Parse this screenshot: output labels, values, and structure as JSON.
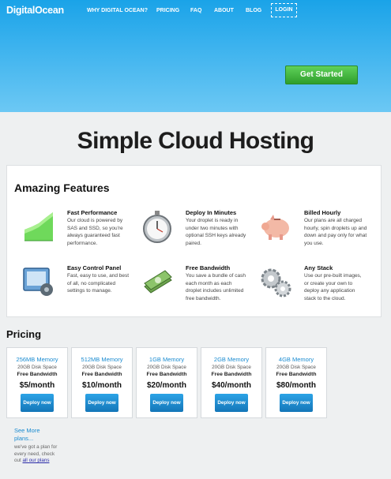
{
  "header": {
    "logo": "DigitalOcean",
    "nav": [
      "WHY DIGITAL OCEAN?",
      "PRICING",
      "FAQ",
      "ABOUT",
      "BLOG"
    ],
    "login": "LOGIN"
  },
  "hero": {
    "cta": "Get Started"
  },
  "headline": "Simple Cloud Hosting",
  "features": {
    "title": "Amazing Features",
    "items": [
      {
        "title": "Fast Performance",
        "desc": "Our cloud is powered by SAS and SSD, so you're always guaranteed fast performance.",
        "icon": "chart-icon"
      },
      {
        "title": "Deploy In Minutes",
        "desc": "Your droplet is ready in under two minutes with optional SSH keys already paired.",
        "icon": "stopwatch-icon"
      },
      {
        "title": "Billed Hourly",
        "desc": "Our plans are all charged hourly, spin droplets up and down and pay only for what you use.",
        "icon": "piggy-bank-icon"
      },
      {
        "title": "Easy Control Panel",
        "desc": "Fast, easy to use, and best of all, no complicated settings to manage.",
        "icon": "control-panel-icon"
      },
      {
        "title": "Free Bandwidth",
        "desc": "You save a bundle of cash each month as each droplet includes unlimited free bandwidth.",
        "icon": "money-icon"
      },
      {
        "title": "Any Stack",
        "desc": "Use our pre-built images, or create your own to deploy any application stack to the cloud.",
        "icon": "gears-icon"
      }
    ]
  },
  "pricing": {
    "title": "Pricing",
    "deploy_label": "Deploy now",
    "plans": [
      {
        "memory": "256MB Memory",
        "disk": "20GB Disk Space",
        "bandwidth": "Free Bandwidth",
        "price": "$5/month"
      },
      {
        "memory": "512MB Memory",
        "disk": "20GB Disk Space",
        "bandwidth": "Free Bandwidth",
        "price": "$10/month"
      },
      {
        "memory": "1GB Memory",
        "disk": "20GB Disk Space",
        "bandwidth": "Free Bandwidth",
        "price": "$20/month"
      },
      {
        "memory": "2GB Memory",
        "disk": "20GB Disk Space",
        "bandwidth": "Free Bandwidth",
        "price": "$40/month"
      },
      {
        "memory": "4GB Memory",
        "disk": "20GB Disk Space",
        "bandwidth": "Free Bandwidth",
        "price": "$80/month"
      }
    ],
    "see_more": "See More plans...",
    "see_more_note": "we've got a plan for every need, check out",
    "see_more_link": "all our plans"
  }
}
